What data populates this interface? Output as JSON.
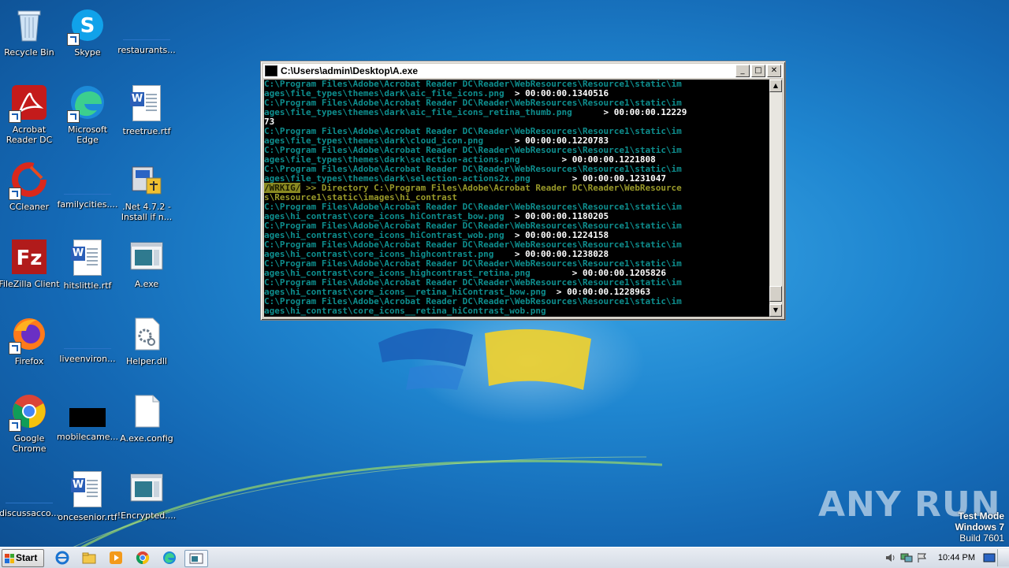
{
  "desktop": {
    "icons": [
      {
        "label": "Recycle Bin"
      },
      {
        "label": "Skype"
      },
      {
        "label": "restaurants..."
      },
      {
        "label": "Acrobat Reader DC"
      },
      {
        "label": "Microsoft Edge"
      },
      {
        "label": "treetrue.rtf"
      },
      {
        "label": "CCleaner"
      },
      {
        "label": "familycities...."
      },
      {
        "label": ".Net 4.7.2 - Install if n..."
      },
      {
        "label": "FileZilla Client"
      },
      {
        "label": "hitslittle.rtf"
      },
      {
        "label": "A.exe"
      },
      {
        "label": "Firefox"
      },
      {
        "label": "liveenviron..."
      },
      {
        "label": "Helper.dll"
      },
      {
        "label": "Google Chrome"
      },
      {
        "label": "mobilecame..."
      },
      {
        "label": "A.exe.config"
      },
      {
        "label": "discussacco..."
      },
      {
        "label": "oncesenior.rtf"
      },
      {
        "label": "!Encrypted...."
      }
    ]
  },
  "console": {
    "title": "C:\\Users\\admin\\Desktop\\A.exe",
    "lines": [
      {
        "c": "C:\\Program Files\\Adobe\\Acrobat Reader DC\\Reader\\WebResources\\Resource1\\static\\im"
      },
      {
        "c": "ages\\file_types\\themes\\dark\\aic_file_icons.png  ",
        "w": "> 00:00:00.1340516"
      },
      {
        "c": "C:\\Program Files\\Adobe\\Acrobat Reader DC\\Reader\\WebResources\\Resource1\\static\\im"
      },
      {
        "c": "ages\\file_types\\themes\\dark\\aic_file_icons_retina_thumb.png      ",
        "w": "> 00:00:00.12229"
      },
      {
        "c": "",
        "w": "73"
      },
      {
        "c": "C:\\Program Files\\Adobe\\Acrobat Reader DC\\Reader\\WebResources\\Resource1\\static\\im"
      },
      {
        "c": "ages\\file_types\\themes\\dark\\cloud_icon.png      ",
        "w": "> 00:00:00.1220783"
      },
      {
        "c": "C:\\Program Files\\Adobe\\Acrobat Reader DC\\Reader\\WebResources\\Resource1\\static\\im"
      },
      {
        "c": "ages\\file_types\\themes\\dark\\selection-actions.png        ",
        "w": "> 00:00:00.1221808"
      },
      {
        "c": "C:\\Program Files\\Adobe\\Acrobat Reader DC\\Reader\\WebResources\\Resource1\\static\\im"
      },
      {
        "c": "ages\\file_types\\themes\\dark\\selection-actions2x.png        ",
        "w": "> 00:00:00.1231047"
      },
      {
        "h": "/WRKIG/",
        "y": " >> Directory C:\\Program Files\\Adobe\\Acrobat Reader DC\\Reader\\WebResource"
      },
      {
        "y": "s\\Resource1\\static\\images\\hi_contrast"
      },
      {
        "c": "C:\\Program Files\\Adobe\\Acrobat Reader DC\\Reader\\WebResources\\Resource1\\static\\im"
      },
      {
        "c": "ages\\hi_contrast\\core_icons_hiContrast_bow.png  ",
        "w": "> 00:00:00.1180205"
      },
      {
        "c": "C:\\Program Files\\Adobe\\Acrobat Reader DC\\Reader\\WebResources\\Resource1\\static\\im"
      },
      {
        "c": "ages\\hi_contrast\\core_icons_hiContrast_wob.png  ",
        "w": "> 00:00:00.1224158"
      },
      {
        "c": "C:\\Program Files\\Adobe\\Acrobat Reader DC\\Reader\\WebResources\\Resource1\\static\\im"
      },
      {
        "c": "ages\\hi_contrast\\core_icons_highcontrast.png    ",
        "w": "> 00:00:00.1238028"
      },
      {
        "c": "C:\\Program Files\\Adobe\\Acrobat Reader DC\\Reader\\WebResources\\Resource1\\static\\im"
      },
      {
        "c": "ages\\hi_contrast\\core_icons_highcontrast_retina.png        ",
        "w": "> 00:00:00.1205826"
      },
      {
        "c": "C:\\Program Files\\Adobe\\Acrobat Reader DC\\Reader\\WebResources\\Resource1\\static\\im"
      },
      {
        "c": "ages\\hi_contrast\\core_icons__retina_hiContrast_bow.png  ",
        "w": "> 00:00:00.1228963"
      },
      {
        "c": "C:\\Program Files\\Adobe\\Acrobat Reader DC\\Reader\\WebResources\\Resource1\\static\\im"
      },
      {
        "c": "ages\\hi_contrast\\core_icons__retina_hiContrast_wob.png"
      }
    ],
    "buttons": {
      "minimize": "_",
      "maximize": "□",
      "close": "✕"
    }
  },
  "watermark": {
    "text": "ANY RUN"
  },
  "testmode": {
    "line1": "Test Mode",
    "line2": "Windows 7",
    "line3": "Build 7601"
  },
  "taskbar": {
    "start_label": "Start",
    "clock": "10:44 PM",
    "pinned_icons": [
      "ie-icon",
      "explorer-icon",
      "media-player-icon",
      "chrome-icon",
      "edge-icon",
      "console-task-icon"
    ]
  },
  "colors": {
    "console_cyan": "#0e8e8e",
    "console_white": "#ffffff",
    "console_yellow": "#9a9a2a"
  }
}
